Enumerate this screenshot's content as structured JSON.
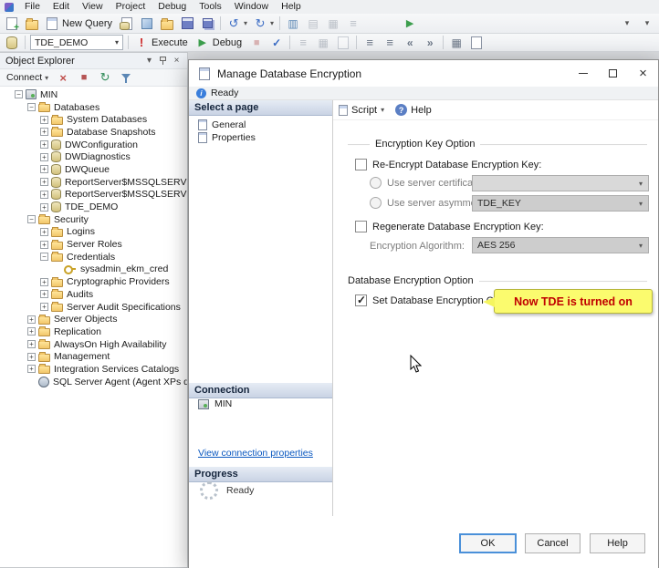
{
  "menu": {
    "items": [
      "File",
      "Edit",
      "View",
      "Project",
      "Debug",
      "Tools",
      "Window",
      "Help"
    ]
  },
  "toolbars": {
    "row1": [
      {
        "t": "icon",
        "name": "new-project-icon",
        "shape": "page-plus"
      },
      {
        "t": "icon",
        "name": "open-project-icon",
        "shape": "folder"
      },
      {
        "t": "button",
        "name": "new-query-button",
        "label": "New Query",
        "shape": "page-sql"
      },
      {
        "t": "icon",
        "name": "database-engine-query-icon",
        "shape": "db-page"
      },
      {
        "t": "icon",
        "name": "analysis-services-query-icon",
        "shape": "cube"
      },
      {
        "t": "icon",
        "name": "open-file-icon",
        "shape": "folder"
      },
      {
        "t": "icon",
        "name": "save-icon",
        "shape": "save"
      },
      {
        "t": "icon",
        "name": "save-all-icon",
        "shape": "save-all"
      },
      {
        "t": "sep"
      },
      {
        "t": "icon",
        "name": "undo-icon",
        "shape": "undo",
        "chevron": true
      },
      {
        "t": "icon",
        "name": "redo-icon",
        "shape": "redo",
        "chevron": true
      },
      {
        "t": "sep"
      },
      {
        "t": "icon",
        "name": "activity-monitor-icon",
        "shape": "chart"
      },
      {
        "t": "icon",
        "name": "profiler-icon",
        "shape": "hatch",
        "dim": true
      },
      {
        "t": "icon",
        "name": "database-tuning-advisor-icon",
        "shape": "grid",
        "dim": true
      },
      {
        "t": "icon",
        "name": "clipboard-icon",
        "shape": "lines",
        "dim": true
      },
      {
        "t": "icon",
        "name": "run-icon",
        "shape": "play-green",
        "ml": 40
      },
      {
        "t": "spacer"
      },
      {
        "t": "icon",
        "name": "toolbar-overflow-icon",
        "shape": "chevron"
      },
      {
        "t": "icon",
        "name": "add-remove-buttons-icon",
        "shape": "chevron"
      }
    ],
    "row2": [
      {
        "t": "icon",
        "name": "change-connection-icon",
        "shape": "db-plug"
      },
      {
        "t": "sep"
      },
      {
        "t": "combo",
        "name": "database-combo",
        "value": "TDE_DEMO"
      },
      {
        "t": "sep"
      },
      {
        "t": "button",
        "name": "execute-button",
        "label": "Execute",
        "shape": "excl"
      },
      {
        "t": "button",
        "name": "debug-button",
        "label": "Debug",
        "shape": "play-green"
      },
      {
        "t": "icon",
        "name": "stop-icon",
        "shape": "stop",
        "dim": true
      },
      {
        "t": "icon",
        "name": "parse-icon",
        "shape": "check"
      },
      {
        "t": "sep"
      },
      {
        "t": "icon",
        "name": "results-to-text-icon",
        "shape": "lines",
        "dim": true
      },
      {
        "t": "icon",
        "name": "results-to-grid-icon",
        "shape": "grid",
        "dim": true
      },
      {
        "t": "icon",
        "name": "results-to-file-icon",
        "shape": "page",
        "dim": true
      },
      {
        "t": "sep"
      },
      {
        "t": "icon",
        "name": "comment-icon",
        "shape": "lines"
      },
      {
        "t": "icon",
        "name": "uncomment-icon",
        "shape": "lines"
      },
      {
        "t": "icon",
        "name": "decrease-indent-icon",
        "shape": "outdent"
      },
      {
        "t": "icon",
        "name": "increase-indent-icon",
        "shape": "indent"
      },
      {
        "t": "sep"
      },
      {
        "t": "icon",
        "name": "intellisense-icon",
        "shape": "grid"
      },
      {
        "t": "icon",
        "name": "query-options-icon",
        "shape": "page"
      }
    ]
  },
  "object_explorer": {
    "title": "Object Explorer",
    "header_icons": [
      "window-position-icon",
      "pin-icon",
      "close-icon"
    ],
    "connect_label": "Connect",
    "tool_icons": [
      {
        "name": "disconnect-icon",
        "shape": "x-red"
      },
      {
        "name": "stop-icon",
        "shape": "stop"
      },
      {
        "name": "refresh-icon",
        "shape": "refresh"
      },
      {
        "name": "filter-icon",
        "shape": "funnel"
      }
    ],
    "tree": [
      {
        "label": "MIN",
        "level": 0,
        "icon": "server",
        "exp": "minus"
      },
      {
        "label": "Databases",
        "level": 1,
        "icon": "folder",
        "exp": "minus"
      },
      {
        "label": "System Databases",
        "level": 2,
        "icon": "folder",
        "exp": "plus"
      },
      {
        "label": "Database Snapshots",
        "level": 2,
        "icon": "folder",
        "exp": "plus"
      },
      {
        "label": "DWConfiguration",
        "level": 2,
        "icon": "database",
        "exp": "plus"
      },
      {
        "label": "DWDiagnostics",
        "level": 2,
        "icon": "database",
        "exp": "plus"
      },
      {
        "label": "DWQueue",
        "level": 2,
        "icon": "database",
        "exp": "plus"
      },
      {
        "label": "ReportServer$MSSQLSERVER",
        "level": 2,
        "icon": "database",
        "exp": "plus"
      },
      {
        "label": "ReportServer$MSSQLSERVERTempDB",
        "level": 2,
        "icon": "database",
        "exp": "plus"
      },
      {
        "label": "TDE_DEMO",
        "level": 2,
        "icon": "database",
        "exp": "plus"
      },
      {
        "label": "Security",
        "level": 1,
        "icon": "folder",
        "exp": "minus"
      },
      {
        "label": "Logins",
        "level": 2,
        "icon": "folder",
        "exp": "plus"
      },
      {
        "label": "Server Roles",
        "level": 2,
        "icon": "folder",
        "exp": "plus"
      },
      {
        "label": "Credentials",
        "level": 2,
        "icon": "folder",
        "exp": "minus"
      },
      {
        "label": "sysadmin_ekm_cred",
        "level": 3,
        "icon": "credential",
        "exp": "none"
      },
      {
        "label": "Cryptographic Providers",
        "level": 2,
        "icon": "folder",
        "exp": "plus"
      },
      {
        "label": "Audits",
        "level": 2,
        "icon": "folder",
        "exp": "plus"
      },
      {
        "label": "Server Audit Specifications",
        "level": 2,
        "icon": "folder",
        "exp": "plus"
      },
      {
        "label": "Server Objects",
        "level": 1,
        "icon": "folder",
        "exp": "plus"
      },
      {
        "label": "Replication",
        "level": 1,
        "icon": "folder",
        "exp": "plus"
      },
      {
        "label": "AlwaysOn High Availability",
        "level": 1,
        "icon": "folder",
        "exp": "plus"
      },
      {
        "label": "Management",
        "level": 1,
        "icon": "folder",
        "exp": "plus"
      },
      {
        "label": "Integration Services Catalogs",
        "level": 1,
        "icon": "folder",
        "exp": "plus"
      },
      {
        "label": "SQL Server Agent (Agent XPs disabl",
        "level": 1,
        "icon": "agent",
        "exp": "none"
      }
    ]
  },
  "dialog": {
    "title": "Manage Database Encryption",
    "status": "Ready",
    "pages": {
      "header": "Select a page",
      "items": [
        {
          "label": "General"
        },
        {
          "label": "Properties"
        }
      ]
    },
    "toolbar": {
      "script": "Script",
      "help": "Help"
    },
    "options": {
      "group_encryption_key": "Encryption Key Option",
      "reencrypt_label": "Re-Encrypt Database Encryption Key:",
      "reencrypt_checked": false,
      "use_cert_label": "Use server certificate:",
      "cert_value": "",
      "use_asym_label": "Use server asymmetric key:",
      "asym_value": "TDE_KEY",
      "regenerate_label": "Regenerate Database Encryption Key:",
      "regenerate_checked": false,
      "algorithm_label": "Encryption Algorithm:",
      "algorithm_value": "AES 256",
      "group_database_encryption": "Database Encryption Option",
      "set_on_label": "Set Database Encryption On",
      "set_on_checked": true
    },
    "callout": {
      "text": "Now TDE is turned on"
    },
    "connection": {
      "header": "Connection",
      "server_name": "MIN",
      "link": "View connection properties"
    },
    "progress": {
      "header": "Progress",
      "status": "Ready"
    },
    "buttons": {
      "ok": "OK",
      "cancel": "Cancel",
      "help": "Help"
    }
  },
  "colors": {
    "callout_bg": "#fbfb6e",
    "callout_text": "#c00000",
    "link": "#0a58c0",
    "pane_header_top": "#e6ecf5",
    "pane_header_bottom": "#c9d3e4",
    "focus_border": "#4a90d9"
  }
}
